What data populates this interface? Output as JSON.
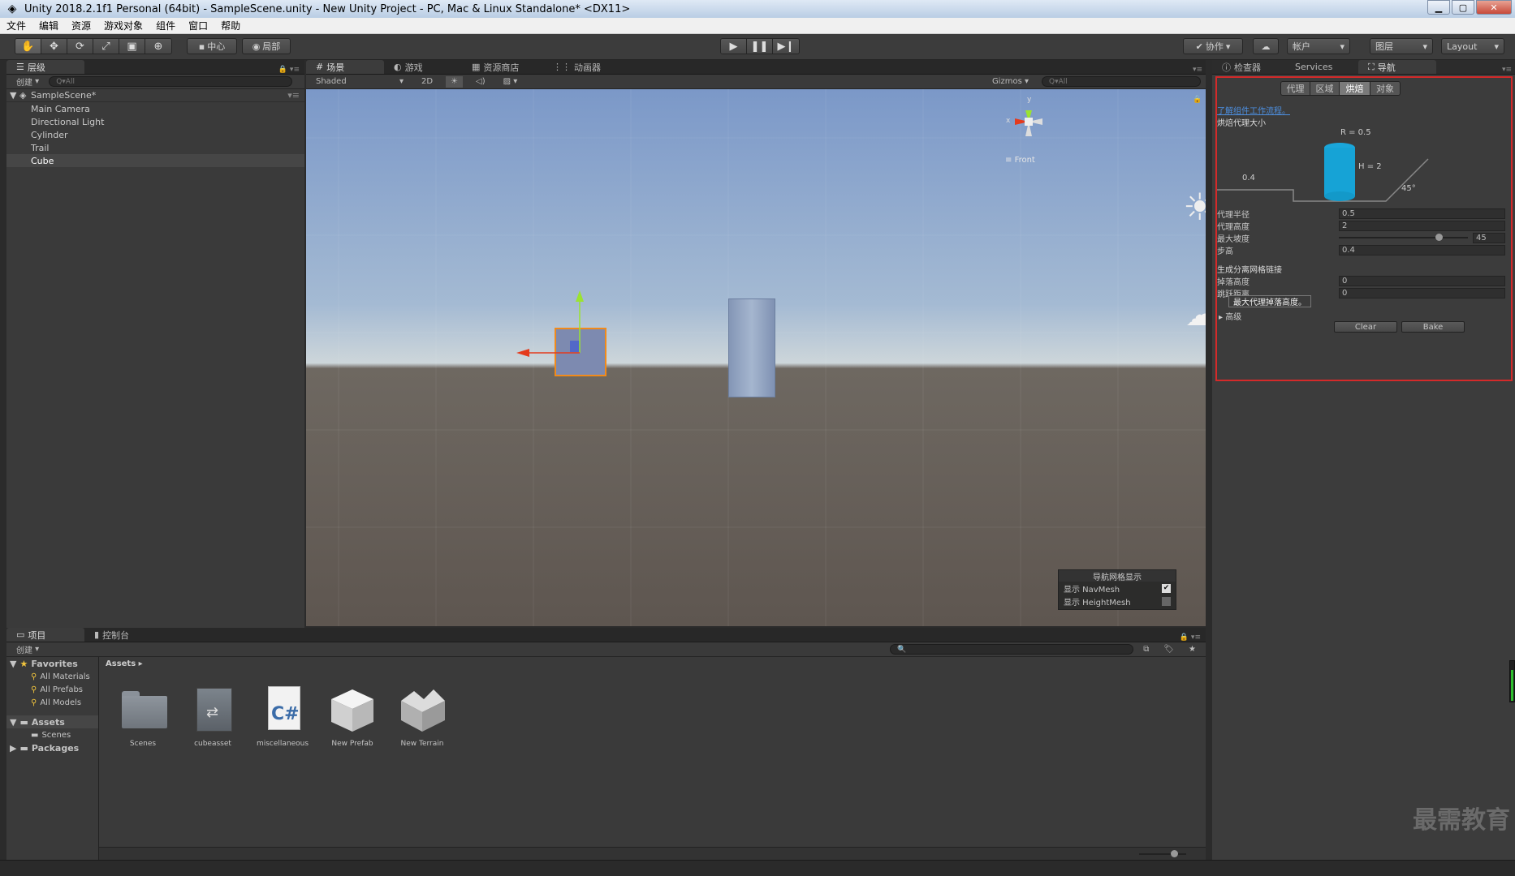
{
  "window": {
    "title": "Unity 2018.2.1f1 Personal (64bit) - SampleScene.unity - New Unity Project - PC, Mac & Linux Standalone* <DX11>"
  },
  "menu": [
    "文件",
    "编辑",
    "资源",
    "游戏对象",
    "组件",
    "窗口",
    "帮助"
  ],
  "toolbar": {
    "pivot": "中心",
    "local": "局部",
    "collab": "协作",
    "account": "帐户",
    "layers": "图层",
    "layout": "Layout"
  },
  "hierarchy": {
    "tab": "层级",
    "create": "创建",
    "search_placeholder": "Q▾All",
    "scene": "SampleScene*",
    "items": [
      "Main Camera",
      "Directional Light",
      "Cylinder",
      "Trail",
      "Cube"
    ]
  },
  "scene": {
    "tabs": [
      "场景",
      "游戏",
      "资源商店",
      "动画器"
    ],
    "shading": "Shaded",
    "mode2d": "2D",
    "gizmos": "Gizmos",
    "search_placeholder": "Q▾All",
    "gizmo_view": "Front",
    "gizmo_x": "x",
    "gizmo_y": "y",
    "overlay": {
      "title": "导航网格显示",
      "show_navmesh": "显示 NavMesh",
      "show_heightmesh": "显示 HeightMesh",
      "navmesh_checked": true,
      "heightmesh_checked": false
    }
  },
  "inspector": {
    "tabs": [
      "检查器",
      "Services",
      "导航"
    ],
    "nav_tabs": [
      "代理",
      "区域",
      "烘焙",
      "对象"
    ],
    "learn_link": "了解组件工作流程。",
    "baked_agent_size": "烘焙代理大小",
    "diagram": {
      "r": "R = 0.5",
      "h": "H = 2",
      "step": "0.4",
      "angle": "45°"
    },
    "props": [
      {
        "label": "代理半径",
        "value": "0.5"
      },
      {
        "label": "代理高度",
        "value": "2"
      },
      {
        "label": "最大坡度",
        "value": "45"
      },
      {
        "label": "步高",
        "value": "0.4"
      }
    ],
    "slope_fraction": 0.75,
    "offmesh_header": "生成分离网格链接",
    "drop_height": {
      "label": "掉落高度",
      "value": "0"
    },
    "jump_distance": {
      "label": "跳跃距离",
      "value": "0"
    },
    "tooltip": "最大代理掉落高度。",
    "advanced": "高级",
    "clear": "Clear",
    "bake": "Bake"
  },
  "project": {
    "tabs": [
      "项目",
      "控制台"
    ],
    "create": "创建",
    "favorites": "Favorites",
    "fav_items": [
      "All Materials",
      "All Prefabs",
      "All Models"
    ],
    "assets_root": "Assets",
    "assets_children": [
      "Scenes"
    ],
    "packages": "Packages",
    "breadcrumb": "Assets",
    "assets": [
      "Scenes",
      "cubeasset",
      "miscellaneous",
      "New Prefab",
      "New Terrain"
    ],
    "cs_label": "C#"
  },
  "watermark": "最需教育",
  "colors": {
    "accent": "#d42a2a",
    "link": "#4d8fe0",
    "cyan": "#16a3d6"
  }
}
